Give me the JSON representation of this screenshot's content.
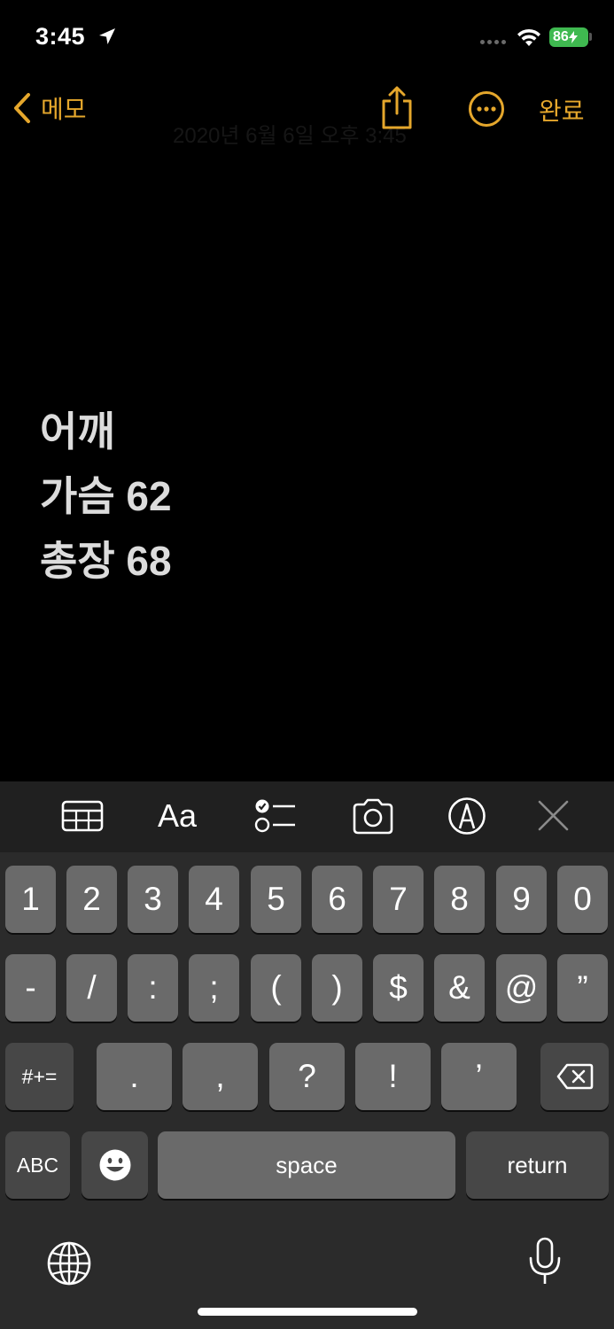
{
  "status_bar": {
    "time": "3:45",
    "battery_level": "86",
    "battery_color": "#3fb950",
    "icons": [
      "location-arrow-icon",
      "cellular-signal-icon",
      "wifi-icon",
      "battery-charging-icon"
    ]
  },
  "nav": {
    "back_label": "메모",
    "date_text": "2020년 6월 6일 오후 3:45",
    "done_label": "완료",
    "accent_color": "#e5a72c",
    "icons": [
      "chevron-left-icon",
      "share-icon",
      "more-icon"
    ]
  },
  "note": {
    "lines": [
      "어깨",
      "가슴 62",
      "총장 68"
    ]
  },
  "toolbar": {
    "font_label": "Aa",
    "icons": [
      "table-icon",
      "text-format-icon",
      "checklist-icon",
      "camera-icon",
      "markup-icon",
      "close-icon"
    ]
  },
  "keyboard": {
    "row1": [
      "1",
      "2",
      "3",
      "4",
      "5",
      "6",
      "7",
      "8",
      "9",
      "0"
    ],
    "row2": [
      "-",
      "/",
      ":",
      ";",
      "(",
      ")",
      "$",
      "&",
      "@",
      "”"
    ],
    "row3": [
      ".",
      ",",
      "?",
      "!",
      "’"
    ],
    "symbols_label": "#+=",
    "abc_label": "ABC",
    "space_label": "space",
    "return_label": "return",
    "icons": [
      "delete-icon",
      "emoji-icon",
      "globe-icon",
      "microphone-icon"
    ]
  }
}
